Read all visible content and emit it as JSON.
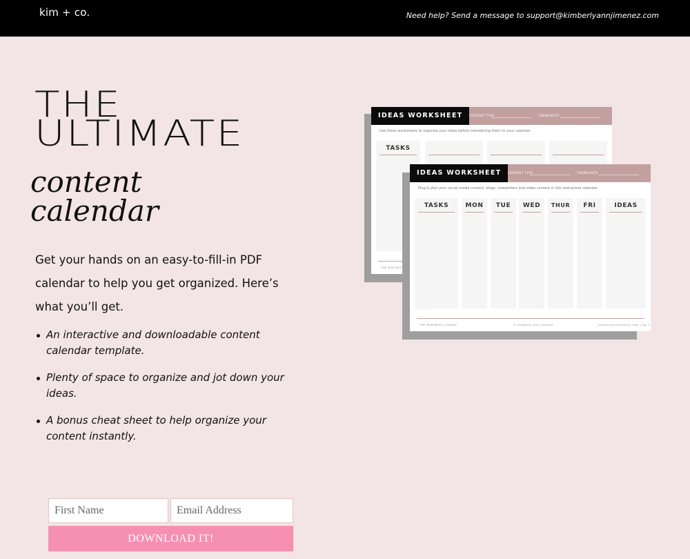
{
  "header": {
    "logo": "kim + co.",
    "help_text": "Need help? Send a message to support@kimberlyannjimenez.com"
  },
  "hero": {
    "line1": "THE",
    "line2": "ULTIMATE",
    "script_line1": "content",
    "script_line2": "calendar"
  },
  "intro": "Get your hands on an easy-to-fill-in PDF calendar to help you get organized. Here’s what you’ll get.",
  "bullets": [
    "An interactive and downloadable content calendar template.",
    "Plenty of space to organize and jot down your ideas.",
    "A bonus cheat sheet to help organize your content instantly."
  ],
  "form": {
    "first_name_placeholder": "First Name",
    "email_placeholder": "Email Address",
    "button_label": "DOWNLOAD IT!"
  },
  "mockup": {
    "back": {
      "title": "IDEAS WORKSHEET",
      "label_a": "CONTENT TYPE",
      "label_b": "THEME/DATE",
      "subtitle": "Use these worksheets to organize your ideas before transferring them to your calendar",
      "col_header": "TASKS",
      "footer_left": "THE BUSINESS"
    },
    "front": {
      "title": "IDEAS WORKSHEET",
      "label_a": "CONTENT TYPE",
      "label_b": "THEME/DATE",
      "subtitle": "Plug & plan your social media content, blogs, newsletters and video content in this interactive calendar.",
      "columns": [
        "TASKS",
        "MON",
        "TUE",
        "WED",
        "THUR",
        "FRI",
        "IDEAS"
      ],
      "footer_left": "THE BUSINESS LOUNGE",
      "footer_center": "© Kimberly Ann Jimenez",
      "footer_right": "kimberlyannjimenez.com | pg 1"
    }
  },
  "colors": {
    "page_bg": "#f3e4e5",
    "topbar": "#000000",
    "accent_pink": "#f590b3",
    "dusty_rose": "#c3a0a0"
  }
}
